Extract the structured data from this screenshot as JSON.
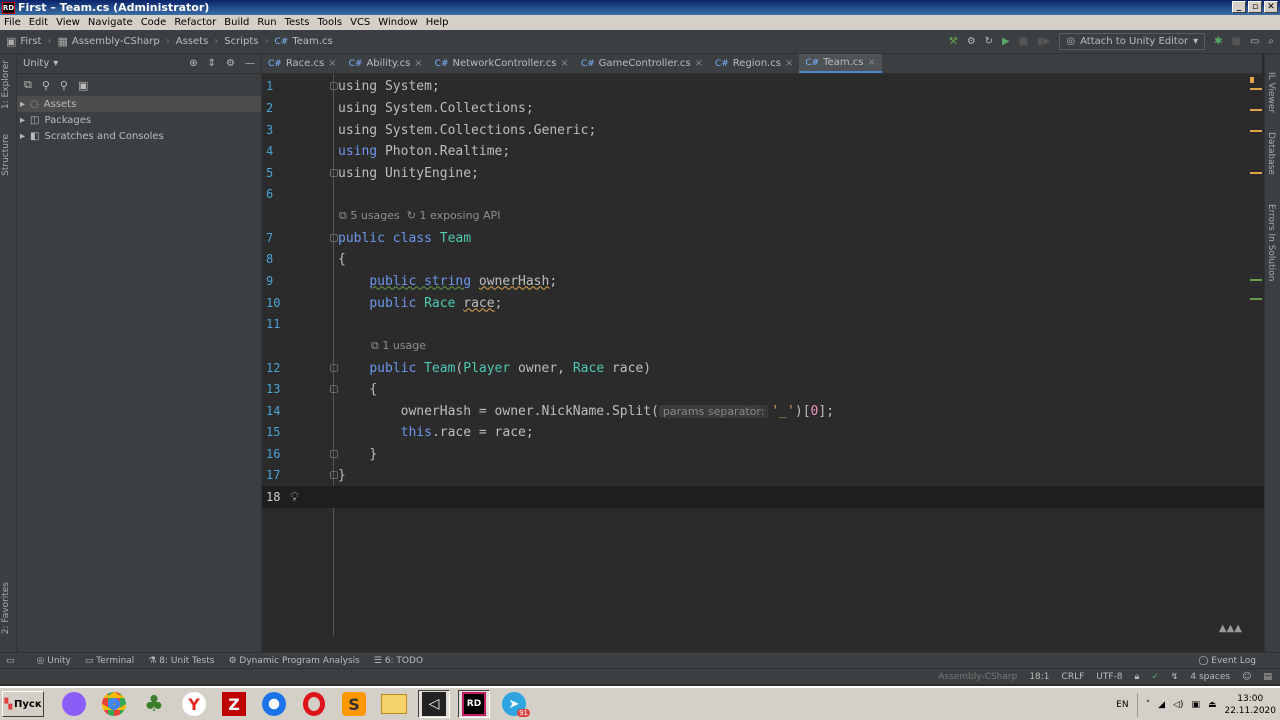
{
  "window": {
    "title": "First – Team.cs (Administrator)"
  },
  "menu": [
    "File",
    "Edit",
    "View",
    "Navigate",
    "Code",
    "Refactor",
    "Build",
    "Run",
    "Tests",
    "Tools",
    "VCS",
    "Window",
    "Help"
  ],
  "breadcrumb": [
    "First",
    "Assembly-CSharp",
    "Assets",
    "Scripts",
    "Team.cs"
  ],
  "toolbar": {
    "attach_label": "Attach to Unity Editor"
  },
  "left_strip": {
    "explorer": "1: Explorer",
    "structure": "Structure",
    "favorites": "2: Favorites"
  },
  "right_strip": {
    "il_viewer": "IL Viewer",
    "database": "Database",
    "errors": "Errors In Solution"
  },
  "side_panel": {
    "view_name": "Unity",
    "tree": [
      {
        "label": "Assets",
        "selected": true
      },
      {
        "label": "Packages",
        "selected": false
      },
      {
        "label": "Scratches and Consoles",
        "selected": false
      }
    ]
  },
  "tabs": [
    {
      "label": "Race.cs",
      "active": false
    },
    {
      "label": "Ability.cs",
      "active": false
    },
    {
      "label": "NetworkController.cs",
      "active": false
    },
    {
      "label": "GameController.cs",
      "active": false
    },
    {
      "label": "Region.cs",
      "active": false
    },
    {
      "label": "Team.cs",
      "active": true
    }
  ],
  "tab_prefix": "C#",
  "editor": {
    "line_numbers": [
      "1",
      "2",
      "3",
      "4",
      "5",
      "6",
      "7",
      "8",
      "9",
      "10",
      "11",
      "12",
      "13",
      "14",
      "15",
      "16",
      "17",
      "18"
    ],
    "hint_class": "5 usages",
    "hint_api": "1 exposing API",
    "hint_ctor": "1 usage",
    "inlay_param": "params separator:",
    "code": {
      "l1": "using System;",
      "l2": "using System.Collections;",
      "l3": "using System.Collections.Generic;",
      "l4_kw": "using",
      "l4_ns": "Photon.Realtime;",
      "l5": "using UnityEngine;",
      "l7_kw": "public class",
      "l7_name": "Team",
      "l8": "{",
      "l9_kw": "public string",
      "l9_field": "ownerHash",
      "l9_end": ";",
      "l10_kw": "public",
      "l10_type": "Race",
      "l10_field": "race",
      "l10_end": ";",
      "l12_kw": "public",
      "l12_name": "Team",
      "l12_p1": "(",
      "l12_t1": "Player",
      "l12_p2": " owner, ",
      "l12_t2": "Race",
      "l12_p3": " race)",
      "l13": "{",
      "l14_a": "ownerHash = owner.NickName.Split(",
      "l14_str": "'_'",
      "l14_b": ")[",
      "l14_num": "0",
      "l14_c": "];",
      "l15_kw": "this",
      "l15_rest": ".race = race;",
      "l16": "}",
      "l17": "}"
    }
  },
  "bottom_tools": [
    "Unity",
    "Terminal",
    "8: Unit Tests",
    "Dynamic Program Analysis",
    "6: TODO"
  ],
  "bottom_right": "Event Log",
  "status": {
    "project": "Assembly-CSharp",
    "position": "18:1",
    "line_sep": "CRLF",
    "encoding": "UTF-8",
    "indent": "4 spaces"
  },
  "taskbar": {
    "start_label": "Пуск",
    "lang": "EN",
    "time": "13:00",
    "date": "22.11.2020",
    "telegram_badge": "91"
  }
}
